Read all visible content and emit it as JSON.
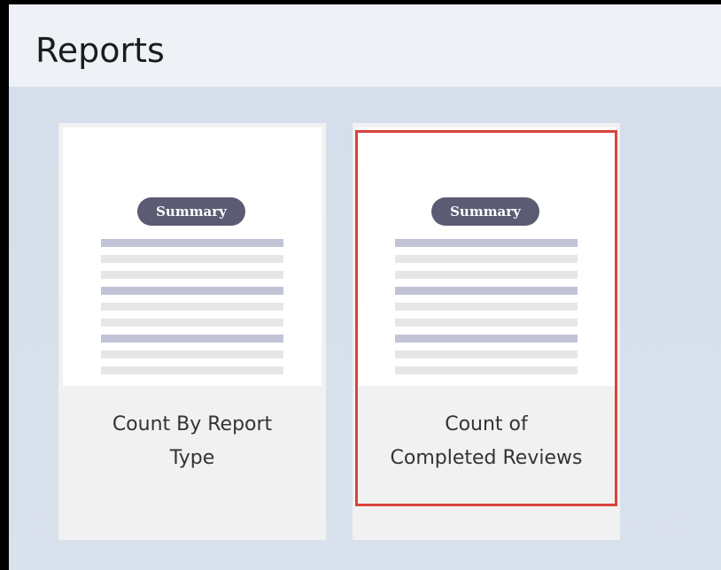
{
  "page": {
    "title": "Reports"
  },
  "cards": [
    {
      "badge": "Summary",
      "title_line1": "Count By Report",
      "title_line2": "Type",
      "selected": false
    },
    {
      "badge": "Summary",
      "title_line1": "Count of",
      "title_line2": "Completed Reviews",
      "selected": true
    }
  ],
  "colors": {
    "selection_border": "#d9433d",
    "badge_bg": "#5b5c73"
  }
}
